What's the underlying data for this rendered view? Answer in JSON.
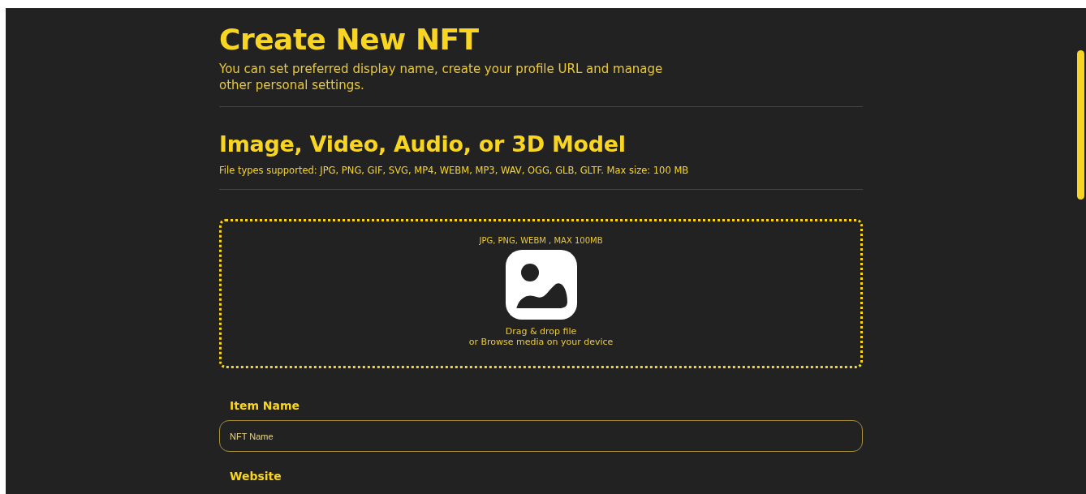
{
  "header": {
    "title": "Create New NFT",
    "subtitle": "You can set preferred display name, create your profile URL and manage other personal settings."
  },
  "media": {
    "title": "Image, Video, Audio, or 3D Model",
    "file_types": "File types supported: JPG, PNG, GIF, SVG, MP4, WEBM, MP3, WAV, OGG, GLB, GLTF. Max size: 100 MB"
  },
  "dropzone": {
    "formats": "JPG, PNG, WEBM , MAX 100MB",
    "line_1": "Drag & drop file",
    "line_2": "or Browse media on your device"
  },
  "fields": [
    {
      "label": "Item Name",
      "placeholder": "NFT Name"
    },
    {
      "label": "Website"
    }
  ]
}
